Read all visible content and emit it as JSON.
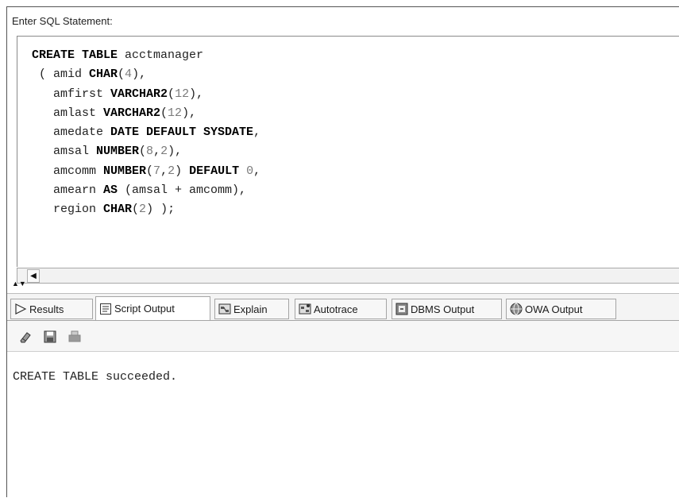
{
  "editor": {
    "label": "Enter SQL Statement:",
    "code": [
      [
        {
          "t": "CREATE TABLE",
          "c": "kw"
        },
        {
          "t": " acctmanager"
        }
      ],
      [
        {
          "t": " ( amid "
        },
        {
          "t": "CHAR",
          "c": "kw"
        },
        {
          "t": "("
        },
        {
          "t": "4",
          "c": "num"
        },
        {
          "t": "),"
        }
      ],
      [
        {
          "t": "   amfirst "
        },
        {
          "t": "VARCHAR2",
          "c": "kw"
        },
        {
          "t": "("
        },
        {
          "t": "12",
          "c": "num"
        },
        {
          "t": "),"
        }
      ],
      [
        {
          "t": "   amlast "
        },
        {
          "t": "VARCHAR2",
          "c": "kw"
        },
        {
          "t": "("
        },
        {
          "t": "12",
          "c": "num"
        },
        {
          "t": "),"
        }
      ],
      [
        {
          "t": "   amedate "
        },
        {
          "t": "DATE DEFAULT SYSDATE",
          "c": "kw"
        },
        {
          "t": ","
        }
      ],
      [
        {
          "t": "   amsal "
        },
        {
          "t": "NUMBER",
          "c": "kw"
        },
        {
          "t": "("
        },
        {
          "t": "8",
          "c": "num"
        },
        {
          "t": ","
        },
        {
          "t": "2",
          "c": "num"
        },
        {
          "t": "),"
        }
      ],
      [
        {
          "t": "   amcomm "
        },
        {
          "t": "NUMBER",
          "c": "kw"
        },
        {
          "t": "("
        },
        {
          "t": "7",
          "c": "num"
        },
        {
          "t": ","
        },
        {
          "t": "2",
          "c": "num"
        },
        {
          "t": ") "
        },
        {
          "t": "DEFAULT",
          "c": "kw"
        },
        {
          "t": " "
        },
        {
          "t": "0",
          "c": "num"
        },
        {
          "t": ","
        }
      ],
      [
        {
          "t": "   amearn "
        },
        {
          "t": "AS",
          "c": "kw"
        },
        {
          "t": " (amsal + amcomm),"
        }
      ],
      [
        {
          "t": "   region "
        },
        {
          "t": "CHAR",
          "c": "kw"
        },
        {
          "t": "("
        },
        {
          "t": "2",
          "c": "num"
        },
        {
          "t": ") );"
        }
      ]
    ]
  },
  "tabs": {
    "results": "Results",
    "script_output": "Script Output",
    "explain": "Explain",
    "autotrace": "Autotrace",
    "dbms_output": "DBMS Output",
    "owa_output": "OWA Output",
    "active": "script_output"
  },
  "toolbar": {
    "icons": [
      "eraser-icon",
      "save-icon",
      "print-icon"
    ]
  },
  "output": {
    "text": "CREATE TABLE succeeded."
  }
}
